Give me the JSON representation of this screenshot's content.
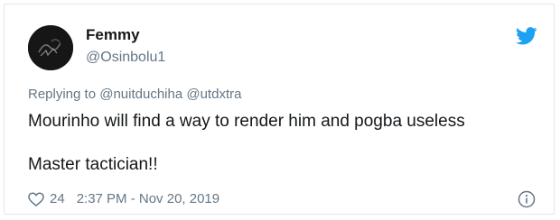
{
  "author": {
    "display_name": "Femmy",
    "handle": "@Osinbolu1"
  },
  "reply": {
    "prefix": "Replying to",
    "mentions": [
      "@nuitduchiha",
      "@utdxtra"
    ]
  },
  "tweet": {
    "line1": "Mourinho will find a way to render him and pogba useless",
    "line2": "Master tactician!!"
  },
  "footer": {
    "likes": "24",
    "timestamp": "2:37 PM - Nov 20, 2019"
  },
  "icons": {
    "brand": "twitter-bird-icon",
    "like": "heart-icon",
    "info": "info-icon"
  },
  "colors": {
    "brand_blue": "#1da1f2",
    "secondary_text": "#657786",
    "primary_text": "#14171a"
  }
}
